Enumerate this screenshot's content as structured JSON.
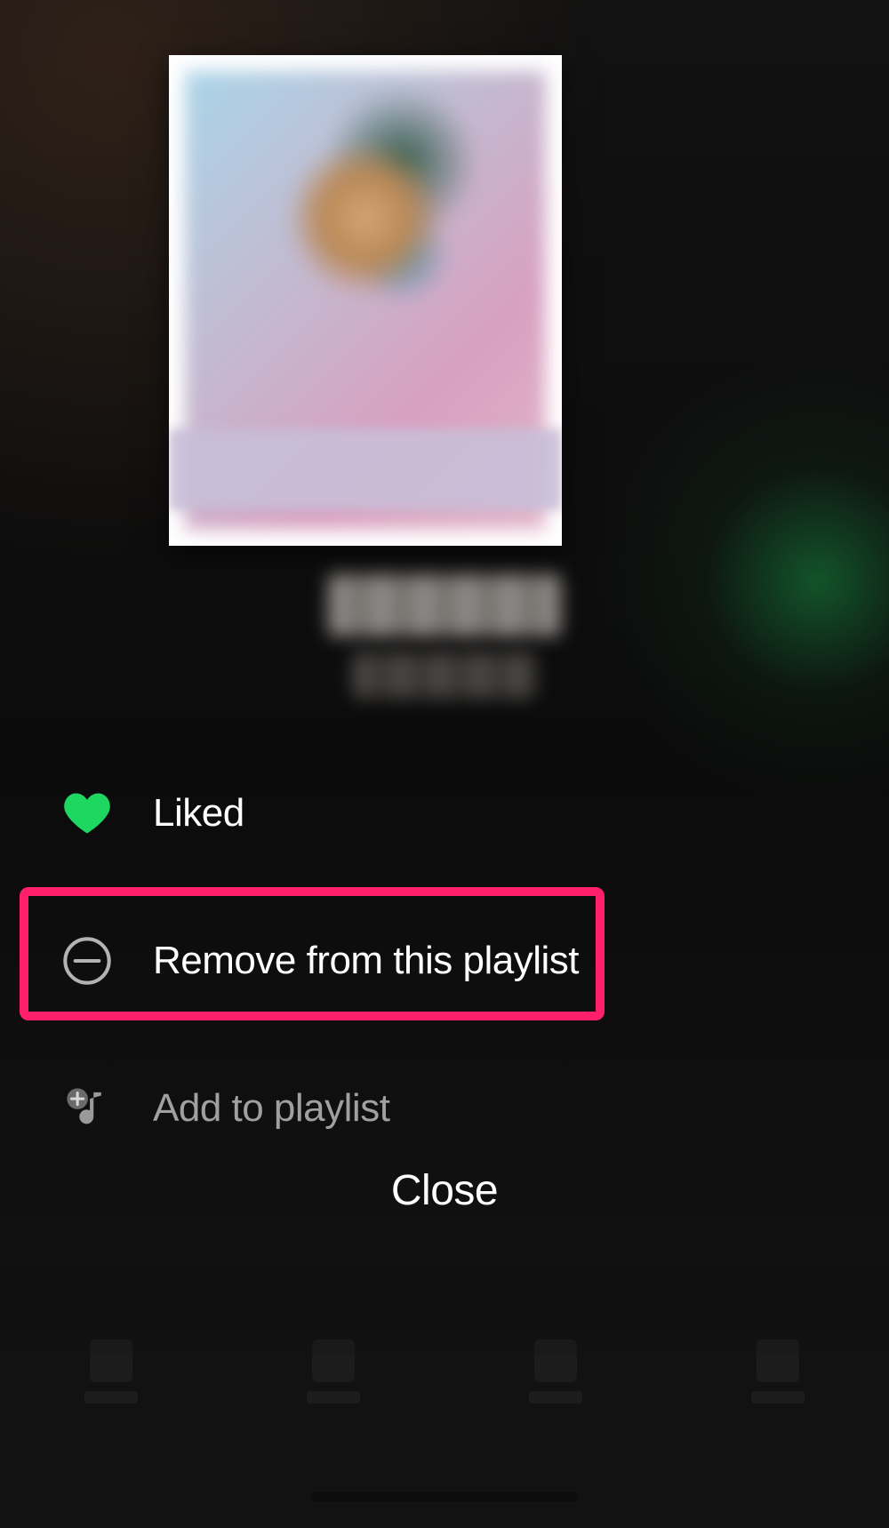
{
  "context_menu": {
    "items": [
      {
        "label": "Liked"
      },
      {
        "label": "Remove from this playlist"
      },
      {
        "label": "Add to playlist"
      }
    ],
    "close_label": "Close"
  },
  "icons": {
    "heart": "heart-icon",
    "remove": "remove-circle-icon",
    "add_to_playlist": "add-music-icon"
  },
  "colors": {
    "accent_green": "#1ed760",
    "highlight_pink": "#ff1f6b"
  }
}
